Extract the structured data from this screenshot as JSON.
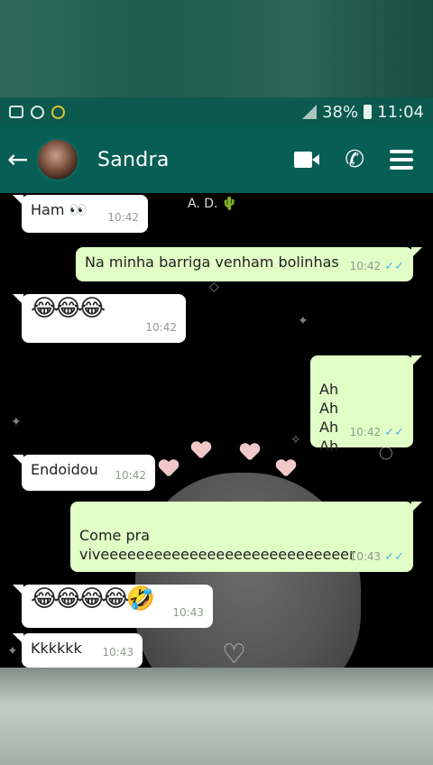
{
  "status_bar": {
    "battery": "38%",
    "time": "11:04"
  },
  "header": {
    "contact_name": "Sandra"
  },
  "watermark": "A. D. 🌵",
  "messages": [
    {
      "direction": "in",
      "text": "Ham 👀",
      "time": "10:42"
    },
    {
      "direction": "out",
      "text": "Na minha barriga venham bolinhas",
      "time": "10:42",
      "ticks": "✓✓"
    },
    {
      "direction": "in",
      "text": "😂😂😂",
      "time": "10:42"
    },
    {
      "direction": "out",
      "text": "Ah\nAh\nAh\nAh",
      "time": "10:42",
      "ticks": "✓✓"
    },
    {
      "direction": "in",
      "text": "Endoidou",
      "time": "10:42"
    },
    {
      "direction": "out",
      "text": "Come pra\nviveeeeeeeeeeeeeeeeeeeeeeeeeeeer",
      "time": "10:43",
      "ticks": "✓✓"
    },
    {
      "direction": "in",
      "text": "😂😂😂😂🤣",
      "time": "10:43"
    },
    {
      "direction": "in",
      "text": "Kkkkkk",
      "time": "10:43"
    }
  ],
  "colors": {
    "appbar": "#075e54",
    "outgoing_bubble": "#e1fec6",
    "incoming_bubble": "#ffffff",
    "read_ticks": "#4fb3ea"
  }
}
